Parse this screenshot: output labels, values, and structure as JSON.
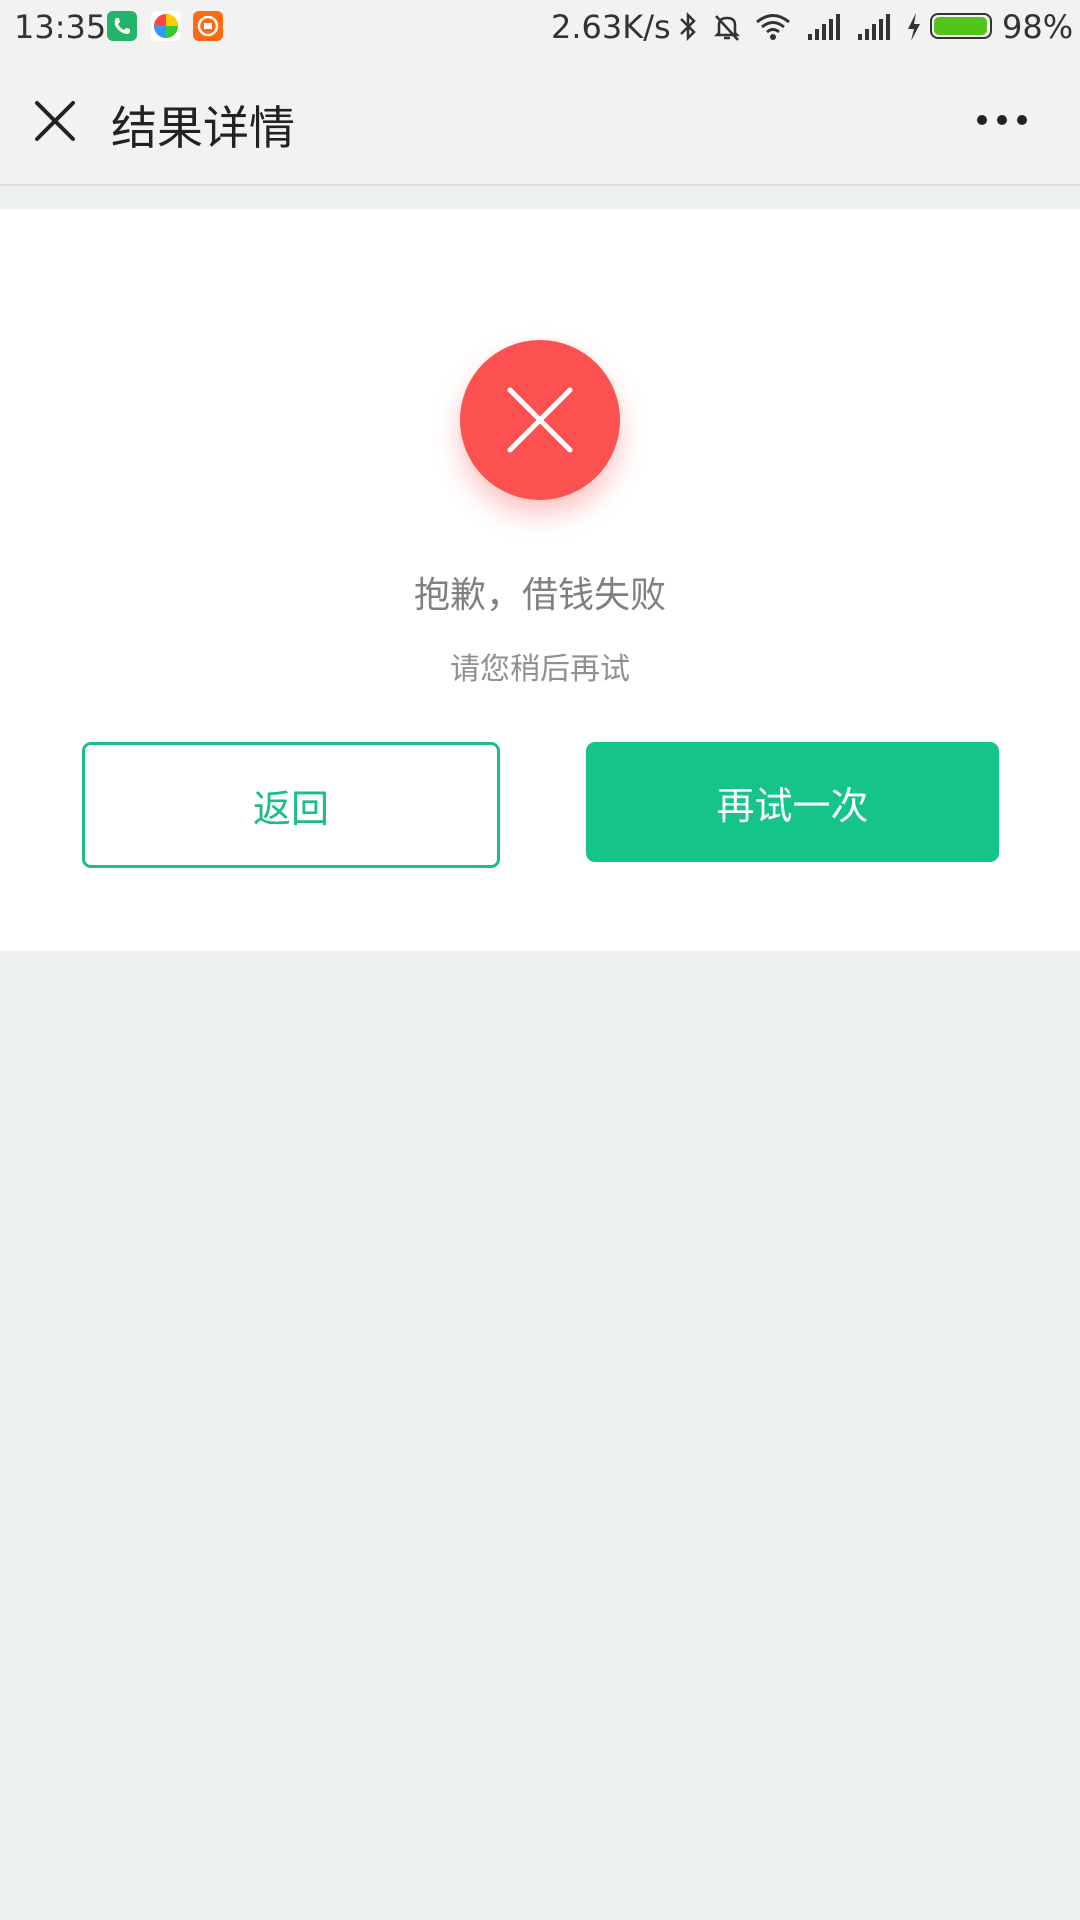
{
  "status_bar": {
    "time": "13:35",
    "net_speed": "2.63K/s",
    "battery_pct": "98%",
    "battery_level": 0.98,
    "notification_icons": [
      "phone-app-icon",
      "color-play-app-icon",
      "mi-app-icon"
    ],
    "status_icons": [
      "bluetooth-icon",
      "mute-bell-icon",
      "wifi-icon",
      "signal-icon",
      "signal-icon",
      "charging-icon",
      "battery-icon"
    ],
    "battery_color": "#52c41a"
  },
  "nav": {
    "title": "结果详情",
    "close_icon": "close-icon",
    "more_icon": "more-icon"
  },
  "result": {
    "icon": "error-x-icon",
    "icon_color": "#fc5151",
    "title": "抱歉，借钱失败",
    "subtitle": "请您稍后再试"
  },
  "actions": {
    "back_label": "返回",
    "retry_label": "再试一次",
    "accent_color": "#15c587"
  }
}
